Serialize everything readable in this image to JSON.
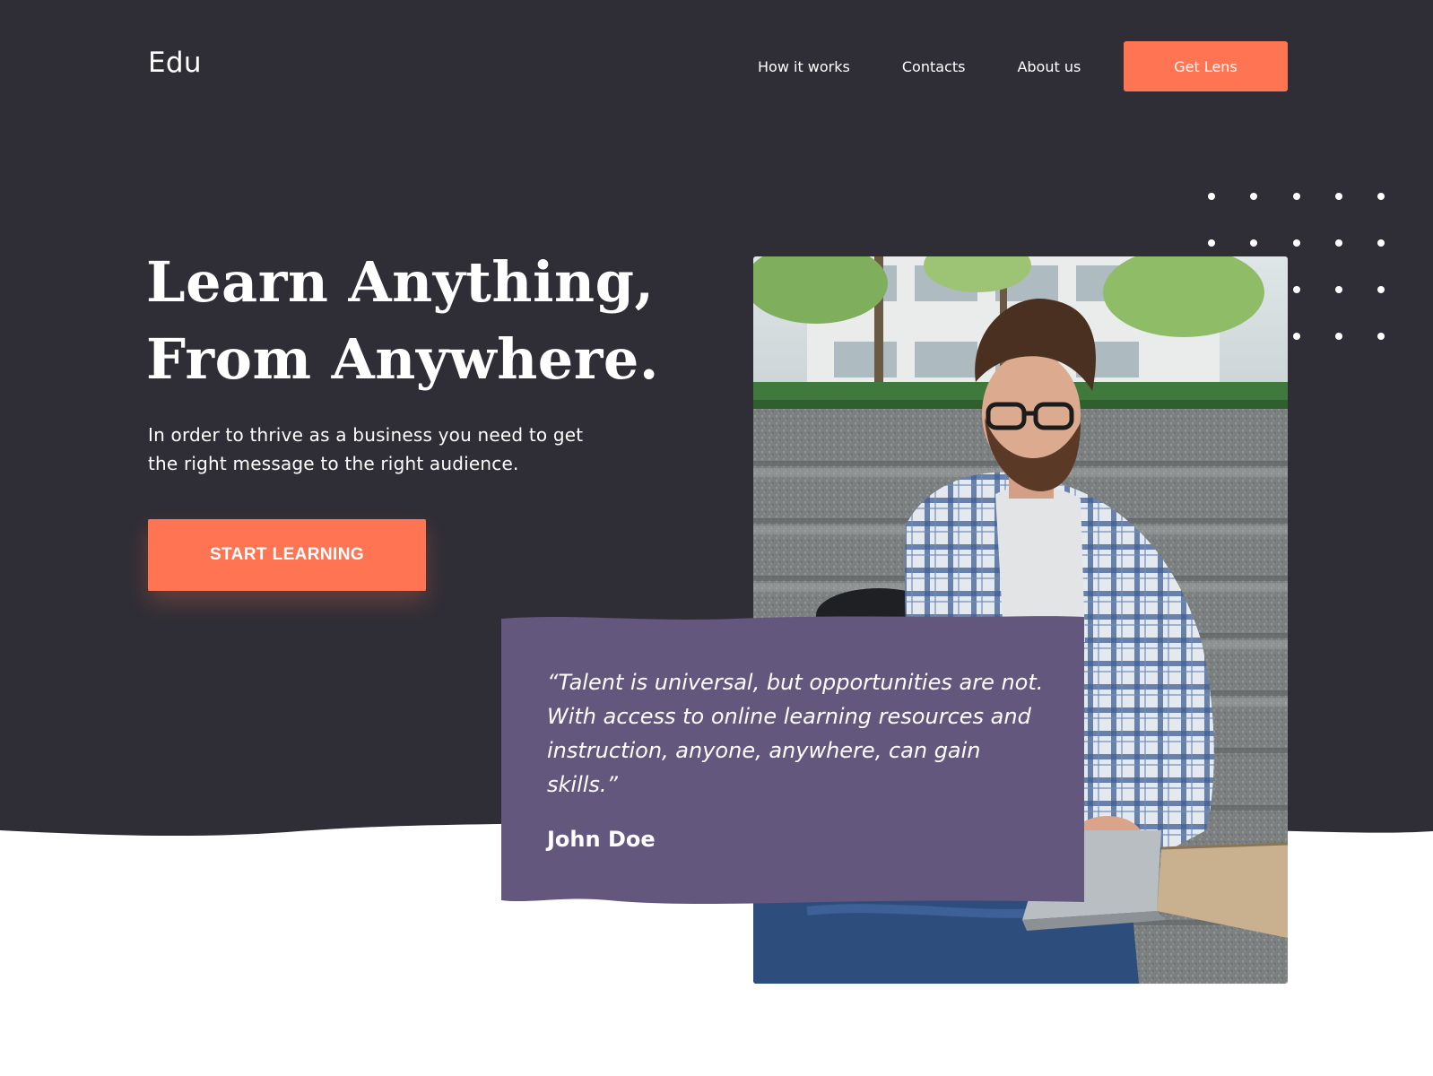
{
  "brand": {
    "logo_text": "Edu"
  },
  "nav": {
    "links": [
      {
        "label": "How it works"
      },
      {
        "label": "Contacts"
      },
      {
        "label": "About us"
      }
    ],
    "cta_label": "Get Lens"
  },
  "hero": {
    "headline_line1": "Learn Anything,",
    "headline_line2": "From Anywhere.",
    "subtext_line1": "In order to thrive as a business you need to get",
    "subtext_line2": "the right message to the right audience.",
    "button_label": "START LEARNING"
  },
  "quote": {
    "text": "“Talent is universal, but opportunities are not. With access to online learning resources and instruction, anyone, anywhere, can gain skills.”",
    "author": "John Doe"
  },
  "colors": {
    "dark_background": "#2f2e36",
    "accent_orange": "#ff7554",
    "quote_purple": "#63577e",
    "white": "#ffffff"
  },
  "icons": {
    "decor": "dot-grid-icon",
    "image": "student-laptop-photo"
  }
}
